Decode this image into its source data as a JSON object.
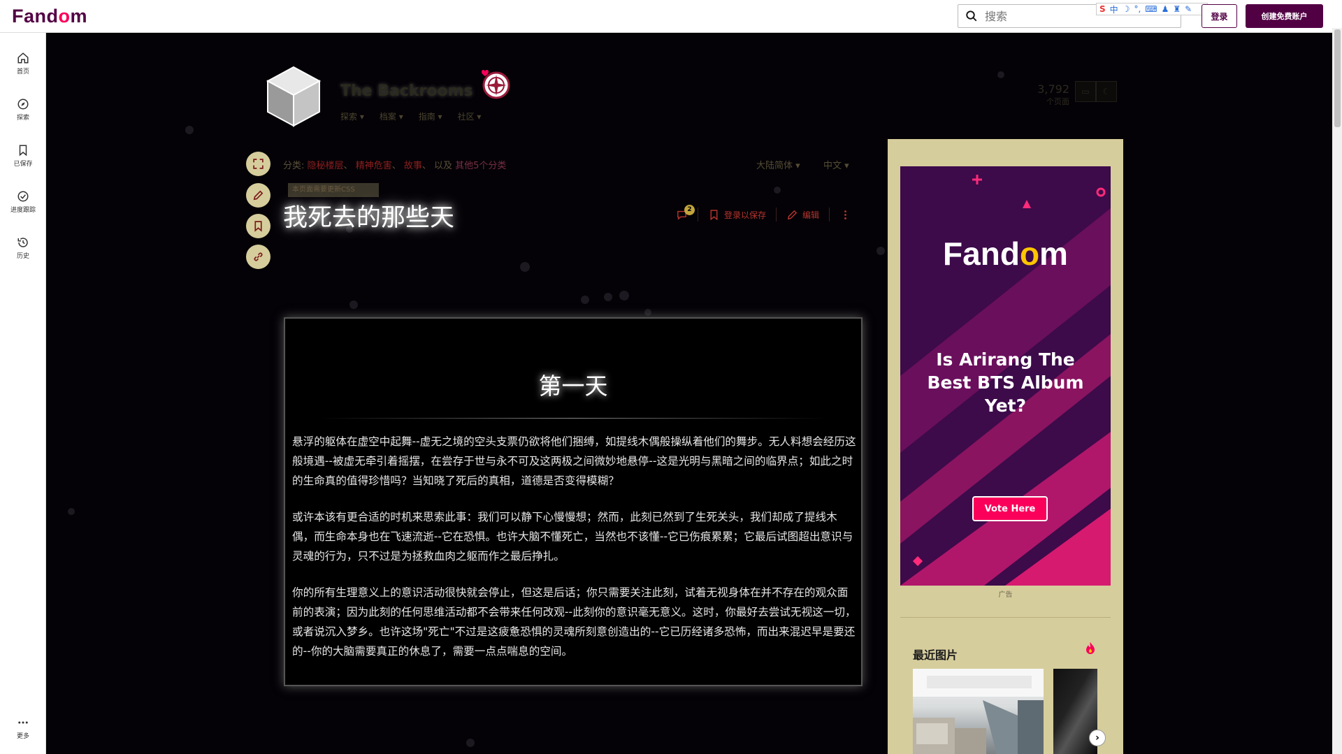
{
  "topbar": {
    "logo_text": "Fandom",
    "logo_pre": "Fand",
    "logo_heart": "o",
    "logo_post": "m",
    "search_placeholder": "搜索",
    "ime_text": "中",
    "login_label": "登录",
    "create_account_label": "创建免费账户",
    "brand_color": "#520044",
    "accent_color": "#fa005a"
  },
  "leftnav": {
    "items": [
      {
        "label": "首页",
        "icon": "home-icon"
      },
      {
        "label": "探索",
        "icon": "compass-icon"
      },
      {
        "label": "已保存",
        "icon": "bookmark-icon"
      },
      {
        "label": "进度跟踪",
        "icon": "check-circle-icon"
      },
      {
        "label": "历史",
        "icon": "history-icon"
      }
    ],
    "more_label": "更多"
  },
  "community": {
    "name": "The Backrooms",
    "tabs": [
      "探索",
      "档案",
      "指南",
      "社区"
    ],
    "page_count": "3,792",
    "page_count_label": "个页面"
  },
  "page": {
    "categories_label": "分类:",
    "categories": [
      "隐秘楼层",
      "精神危害",
      "故事"
    ],
    "categories_and": "以及",
    "categories_more": "其他5个分类",
    "variant_label": "大陆简体",
    "language_label": "中文",
    "tag_badge": "本页面需要更新CSS",
    "title": "我死去的那些天",
    "comment_count": "2",
    "save_label": "登录以保存",
    "edit_label": "编辑"
  },
  "article": {
    "heading": "第一天",
    "paragraphs": [
      "悬浮的躯体在虚空中起舞--虚无之境的空头支票仍欲将他们捆缚，如提线木偶般操纵着他们的舞步。无人料想会经历这般境遇--被虚无牵引着摇摆，在尝存于世与永不可及这两极之间微妙地悬停--这是光明与黑暗之间的临界点；如此之时的生命真的值得珍惜吗？当知晓了死后的真相，道德是否变得模糊？",
      "或许本该有更合适的时机来思索此事：我们可以静下心慢慢想；然而，此刻已然到了生死关头，我们却成了提线木偶，而生命本身也在飞速流逝--它在恐惧。也许大脑不懂死亡，当然也不该懂--它已伤痕累累；它最后试图超出意识与灵魂的行为，只不过是为拯救血肉之躯而作之最后挣扎。",
      "你的所有生理意义上的意识活动很快就会停止，但这是后话；你只需要关注此刻，试着无视身体在并不存在的观众面前的表演；因为此刻的任何思维活动都不会带来任何改观--此刻你的意识毫无意义。这时，你最好去尝试无视这一切，或者说沉入梦乡。也许这场\"死亡\"不过是这疲惫恐惧的灵魂所刻意创造出的--它已历经诸多恐怖，而出来混迟早是要还的--你的大脑需要真正的休息了，需要一点点喘息的空间。"
    ]
  },
  "rail": {
    "ad": {
      "logo_pre": "Fand",
      "logo_heart": "o",
      "logo_post": "m",
      "headline": "Is Arirang The Best BTS Album Yet?",
      "button_label": "Vote Here"
    },
    "ad_label": "广告",
    "recent_images_title": "最近图片"
  }
}
